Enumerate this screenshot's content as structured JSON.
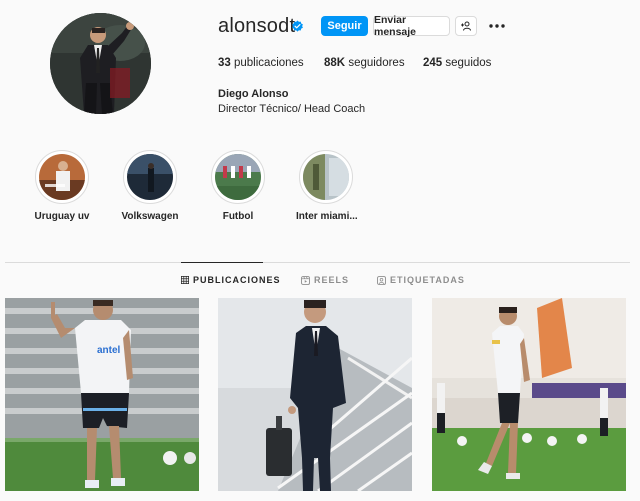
{
  "profile": {
    "username": "alonsodt",
    "verified": true,
    "full_name": "Diego Alonso",
    "bio": "Director Técnico/ Head Coach"
  },
  "actions": {
    "follow_label": "Seguir",
    "message_label": "Enviar mensaje"
  },
  "stats": {
    "posts_count": "33",
    "posts_label": "publicaciones",
    "followers_count": "88K",
    "followers_label": "seguidores",
    "following_count": "245",
    "following_label": "seguidos"
  },
  "highlights": [
    {
      "label": "Uruguay uv"
    },
    {
      "label": "Volkswagen"
    },
    {
      "label": "Futbol"
    },
    {
      "label": "Inter miami..."
    }
  ],
  "tabs": [
    {
      "label": "PUBLICACIONES",
      "icon": "grid-icon",
      "active": true
    },
    {
      "label": "REELS",
      "icon": "reels-icon",
      "active": false
    },
    {
      "label": "ETIQUETADAS",
      "icon": "tagged-icon",
      "active": false
    }
  ],
  "posts": [
    {
      "description": "coach on training pitch pointing",
      "shirt_text": "antel"
    },
    {
      "description": "man in suit descending airplane stairs"
    },
    {
      "description": "coach walking on stadium pitch"
    }
  ],
  "colors": {
    "accent": "#0095f6",
    "text": "#262626",
    "muted": "#8e8e8e",
    "border": "#dbdbdb",
    "background": "#fafafa"
  }
}
